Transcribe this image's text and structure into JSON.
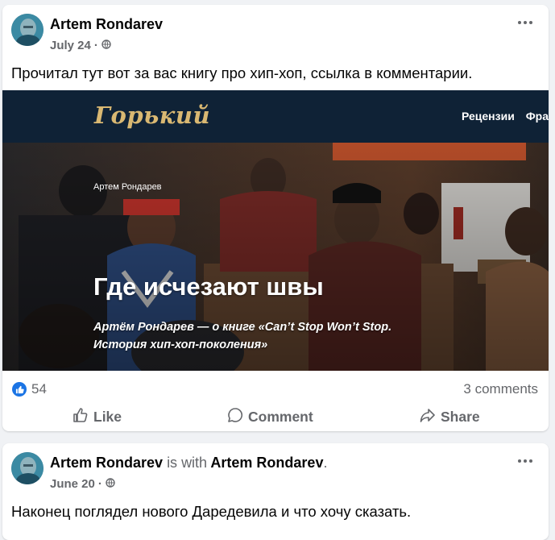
{
  "posts": [
    {
      "author": "Artem Rondarev",
      "date": "July 24",
      "privacy_icon": "globe-icon",
      "text": "Прочитал тут вот за вас книгу про хип-хоп, ссылка в комментарии.",
      "link_preview": {
        "site_logo": "Горький",
        "nav": [
          "Рецензии",
          "Фраг"
        ],
        "article_author": "Артем Рондарев",
        "title": "Где исчезают швы",
        "subtitle": "Артём Рондарев — о книге «Can’t Stop Won’t Stop. История хип-хоп-поколения»"
      },
      "reactions_count": "54",
      "comments": "3 comments",
      "actions": {
        "like": "Like",
        "comment": "Comment",
        "share": "Share"
      }
    },
    {
      "author": "Artem Rondarev",
      "with_text": "is with",
      "tagged": "Artem Rondarev",
      "punct": ".",
      "date": "June 20",
      "privacy_icon": "globe-icon",
      "text": "Наконец поглядел нового Даредевила и что хочу сказать."
    }
  ],
  "colors": {
    "background": "#f0f2f5",
    "card": "#ffffff",
    "secondary_text": "#65676b",
    "like_blue": "#1b74e4",
    "site_header": "#0f2236",
    "site_logo": "#d9b872"
  }
}
